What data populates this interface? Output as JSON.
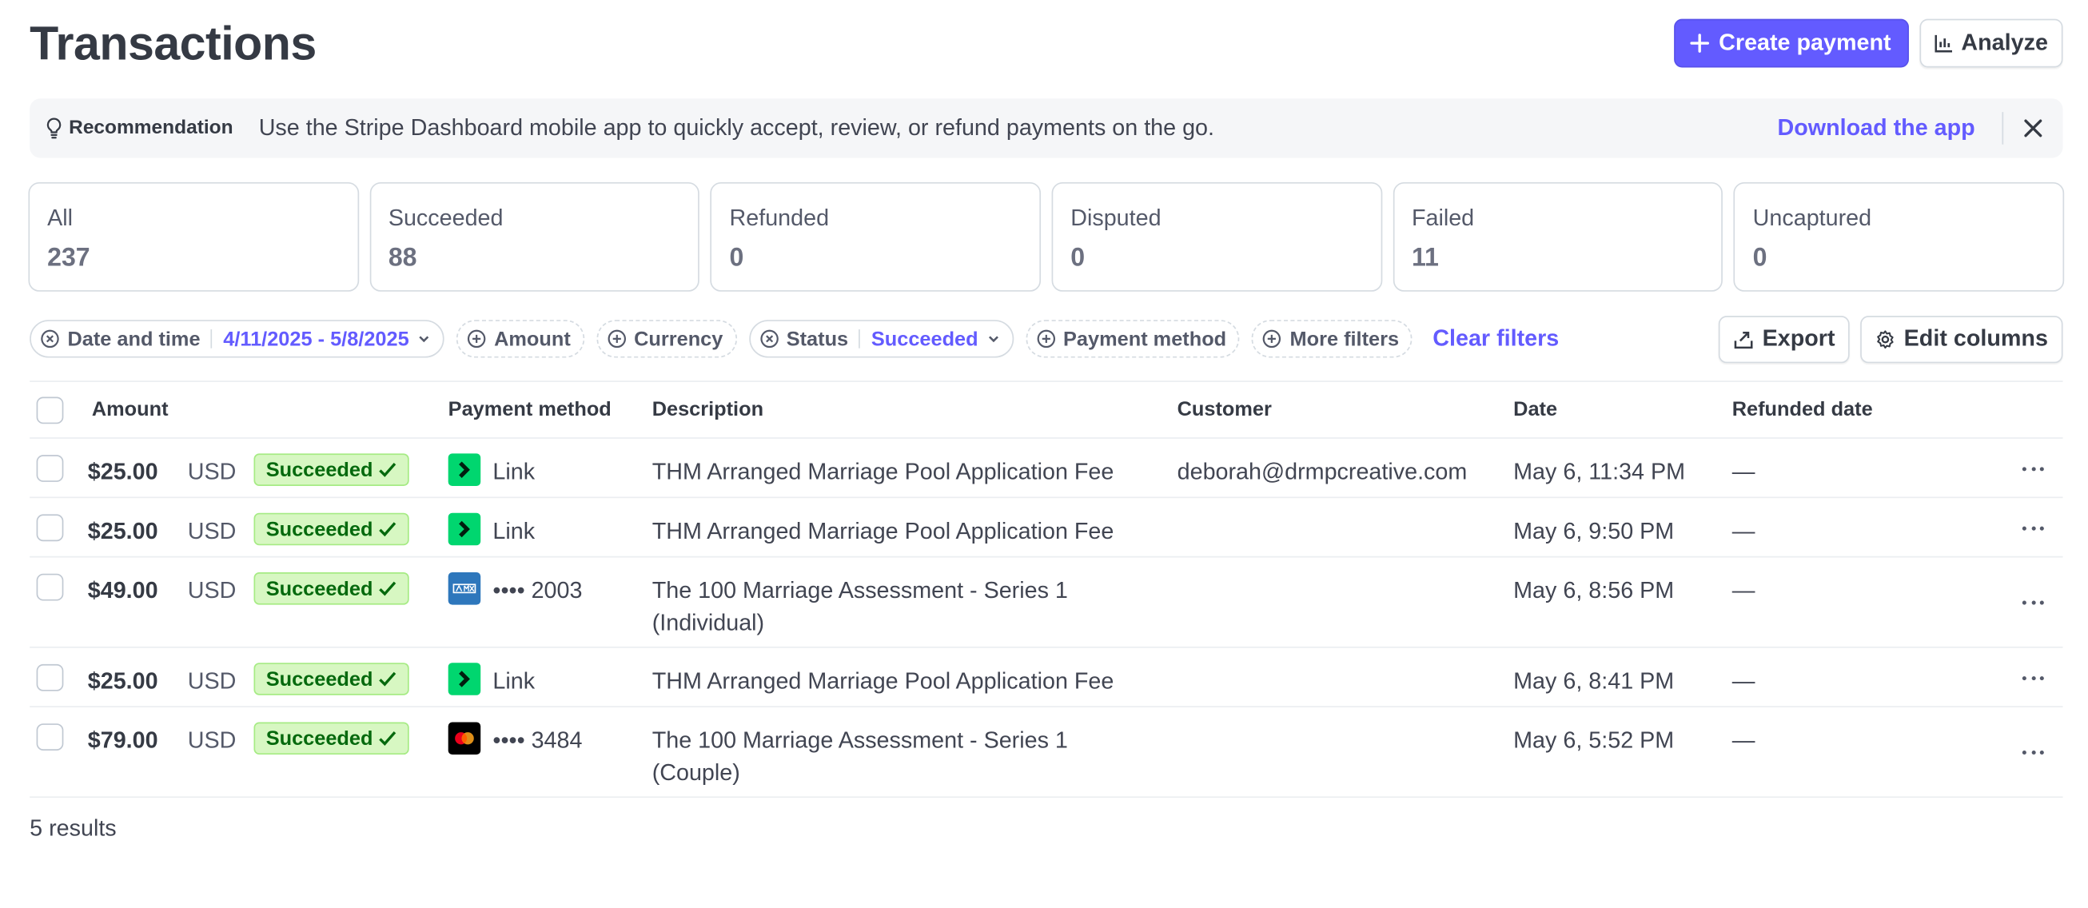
{
  "header": {
    "title": "Transactions",
    "create_payment_label": "Create payment",
    "analyze_label": "Analyze"
  },
  "recommendation": {
    "label": "Recommendation",
    "text": "Use the Stripe Dashboard mobile app to quickly accept, review, or refund payments on the go.",
    "link_label": "Download the app"
  },
  "status_cards": [
    {
      "label": "All",
      "count": "237"
    },
    {
      "label": "Succeeded",
      "count": "88"
    },
    {
      "label": "Refunded",
      "count": "0"
    },
    {
      "label": "Disputed",
      "count": "0"
    },
    {
      "label": "Failed",
      "count": "11"
    },
    {
      "label": "Uncaptured",
      "count": "0"
    }
  ],
  "filters": {
    "date": {
      "label": "Date and time",
      "value": "4/11/2025 - 5/8/2025"
    },
    "amount": {
      "label": "Amount"
    },
    "currency": {
      "label": "Currency"
    },
    "status": {
      "label": "Status",
      "value": "Succeeded"
    },
    "payment_method": {
      "label": "Payment method"
    },
    "more": {
      "label": "More filters"
    },
    "clear_label": "Clear filters",
    "export_label": "Export",
    "edit_columns_label": "Edit columns"
  },
  "table": {
    "columns": [
      "Amount",
      "Payment method",
      "Description",
      "Customer",
      "Date",
      "Refunded date"
    ],
    "rows": [
      {
        "amount": "$25.00",
        "currency": "USD",
        "status": "Succeeded",
        "pm_icon": "link-icon",
        "pm_text": "Link",
        "description": "THM Arranged Marriage Pool Application Fee",
        "customer": "deborah@drmpcreative.com",
        "date": "May 6, 11:34 PM",
        "refunded": "—"
      },
      {
        "amount": "$25.00",
        "currency": "USD",
        "status": "Succeeded",
        "pm_icon": "link-icon",
        "pm_text": "Link",
        "description": "THM Arranged Marriage Pool Application Fee",
        "customer": "",
        "date": "May 6, 9:50 PM",
        "refunded": "—"
      },
      {
        "amount": "$49.00",
        "currency": "USD",
        "status": "Succeeded",
        "pm_icon": "amex-icon",
        "pm_text": "•••• 2003",
        "description": "The 100 Marriage Assessment - Series 1 (Individual)",
        "customer": "",
        "date": "May 6, 8:56 PM",
        "refunded": "—"
      },
      {
        "amount": "$25.00",
        "currency": "USD",
        "status": "Succeeded",
        "pm_icon": "link-icon",
        "pm_text": "Link",
        "description": "THM Arranged Marriage Pool Application Fee",
        "customer": "",
        "date": "May 6, 8:41 PM",
        "refunded": "—"
      },
      {
        "amount": "$79.00",
        "currency": "USD",
        "status": "Succeeded",
        "pm_icon": "mastercard-icon",
        "pm_text": "•••• 3484",
        "description": "The 100 Marriage Assessment - Series 1 (Couple)",
        "customer": "",
        "date": "May 6, 5:52 PM",
        "refunded": "—"
      }
    ]
  },
  "results_text": "5 results",
  "colors": {
    "accent": "#635bff",
    "success_bg": "#d7f7c2",
    "success_text": "#05690d",
    "link_green": "#00d66f"
  }
}
